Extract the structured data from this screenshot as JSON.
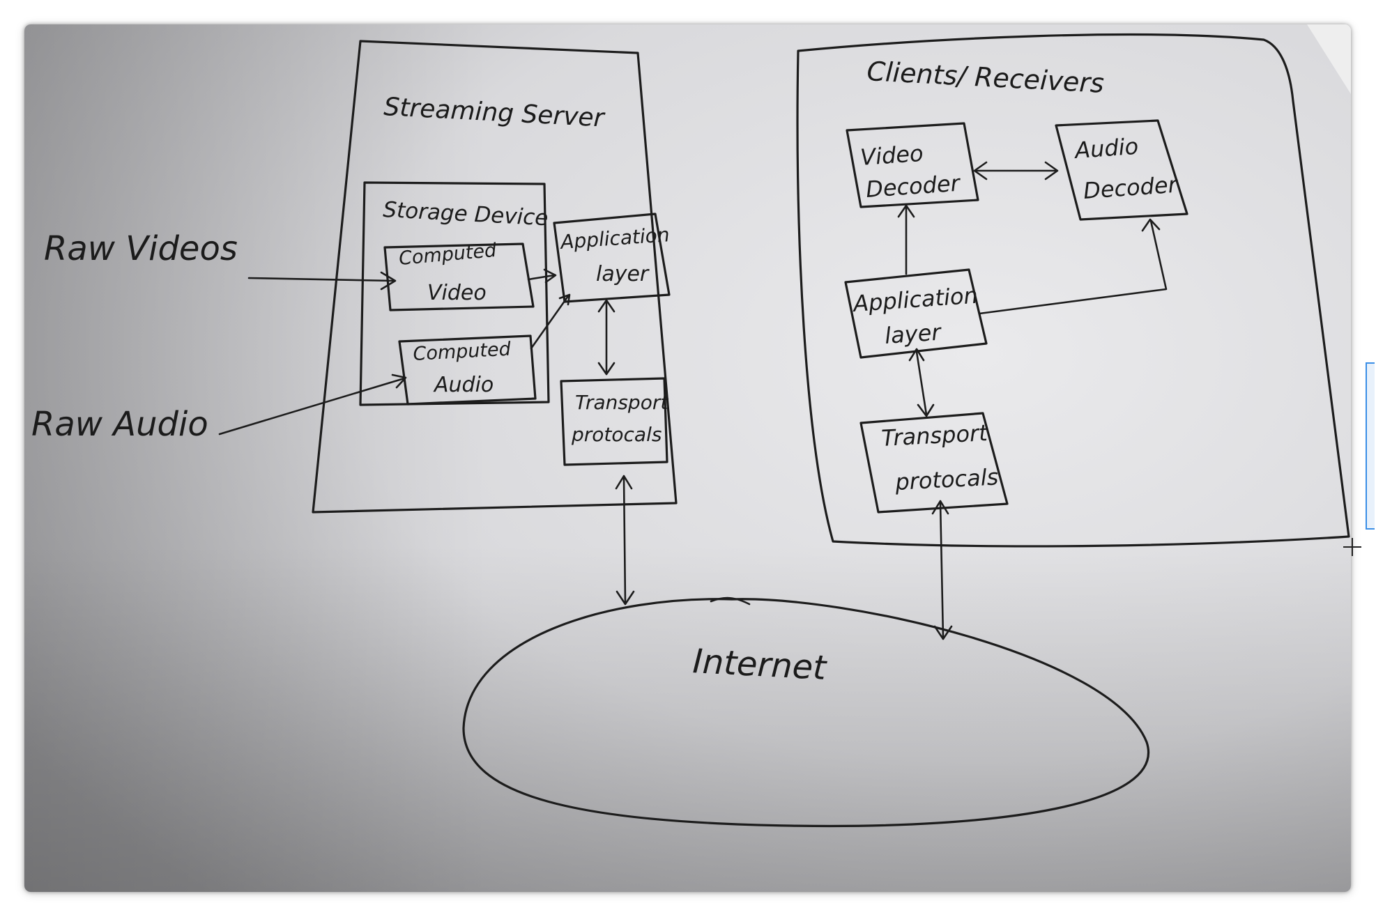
{
  "diagram": {
    "server_group": {
      "title": "Streaming Server"
    },
    "client_group": {
      "title": "Clients/ Receivers"
    },
    "storage_device": {
      "label": "Storage Device"
    },
    "server_compressed_video": {
      "line1": "Computed",
      "line2": "Video"
    },
    "server_compressed_audio": {
      "line1": "Computed",
      "line2": "Audio"
    },
    "server_application_layer": {
      "line1": "Application",
      "line2": "layer"
    },
    "server_transport": {
      "line1": "Transport",
      "line2": "protocals"
    },
    "client_video_decoder": {
      "line1": "Video",
      "line2": "Decoder"
    },
    "client_audio_decoder": {
      "line1": "Audio",
      "line2": "Decoder"
    },
    "client_application_layer": {
      "line1": "Application",
      "line2": "layer"
    },
    "client_transport": {
      "line1": "Transport",
      "line2": "protocals"
    },
    "raw_videos": {
      "label": "Raw Videos"
    },
    "raw_audio": {
      "label": "Raw Audio"
    },
    "internet": {
      "label": "Internet"
    }
  },
  "colors": {
    "paper": "#d6d6d8",
    "ink": "#1c1c1c",
    "selection_accent": "#3a8ee6"
  }
}
